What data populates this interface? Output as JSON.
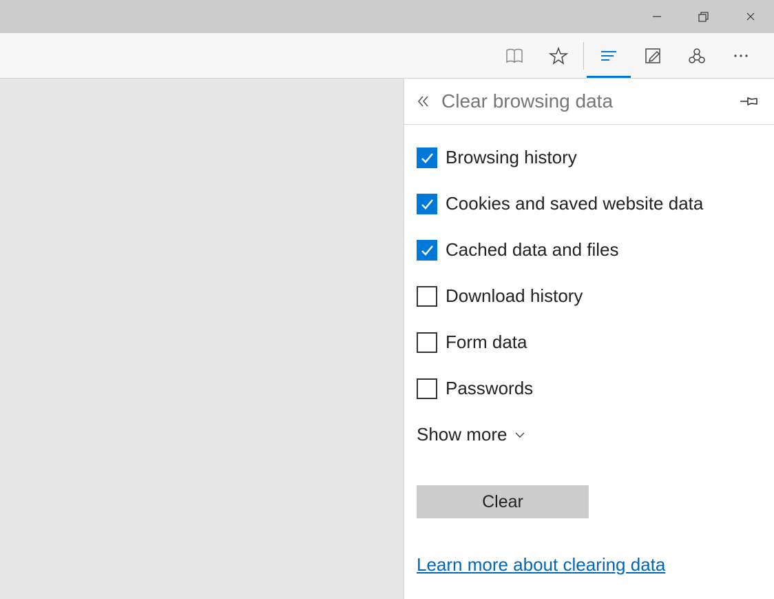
{
  "panel": {
    "title": "Clear browsing data",
    "items": [
      {
        "label": "Browsing history",
        "checked": true
      },
      {
        "label": "Cookies and saved website data",
        "checked": true
      },
      {
        "label": "Cached data and files",
        "checked": true
      },
      {
        "label": "Download history",
        "checked": false
      },
      {
        "label": "Form data",
        "checked": false
      },
      {
        "label": "Passwords",
        "checked": false
      }
    ],
    "show_more": "Show more",
    "clear_button": "Clear",
    "learn_link": "Learn more about clearing data"
  },
  "colors": {
    "accent": "#0078d7"
  }
}
